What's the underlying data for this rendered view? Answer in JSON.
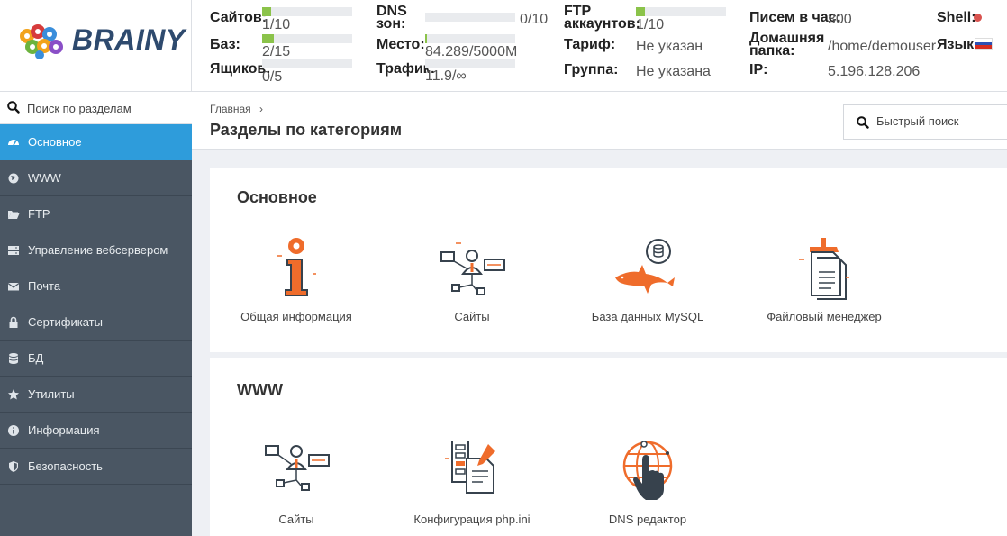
{
  "brand": {
    "name": "BRAINY"
  },
  "stats": {
    "sites": {
      "label": "Сайтов:",
      "value": "1/10",
      "fill": 0.1
    },
    "dbs": {
      "label": "Баз:",
      "value": "2/15",
      "fill": 0.13
    },
    "boxes": {
      "label": "Ящиков:",
      "value": "0/5",
      "fill": 0
    },
    "dns": {
      "label": "DNS зон:",
      "value": "0/10",
      "fill": 0
    },
    "space": {
      "label": "Место:",
      "value": "84.289/5000M",
      "fill": 0.017
    },
    "traffic": {
      "label": "Трафик:",
      "value": "11.9/∞",
      "fill": 0
    },
    "ftp": {
      "label": "FTP аккаунтов:",
      "value": "1/10",
      "fill": 0.1
    },
    "tariff": {
      "label": "Тариф:",
      "value": "Не указан"
    },
    "group": {
      "label": "Группа:",
      "value": "Не указана"
    },
    "mails": {
      "label": "Писем в час:",
      "value": "300"
    },
    "home": {
      "label": "Домашняя папка:",
      "value": "/home/demouser"
    },
    "ip": {
      "label": "IP:",
      "value": "5.196.128.206"
    },
    "shell": {
      "label": "Shell:",
      "status_color": "#d9534f"
    },
    "lang": {
      "label": "Язык:",
      "flag": "russia-flag"
    }
  },
  "sidebar": {
    "search_placeholder": "Поиск по разделам",
    "items": [
      {
        "label": "Основное",
        "icon": "dashboard-icon",
        "active": true
      },
      {
        "label": "WWW",
        "icon": "globe-icon"
      },
      {
        "label": "FTP",
        "icon": "folder-open-icon"
      },
      {
        "label": "Управление вебсервером",
        "icon": "server-icon"
      },
      {
        "label": "Почта",
        "icon": "envelope-icon"
      },
      {
        "label": "Сертификаты",
        "icon": "lock-icon"
      },
      {
        "label": "БД",
        "icon": "database-icon"
      },
      {
        "label": "Утилиты",
        "icon": "star-icon"
      },
      {
        "label": "Информация",
        "icon": "info-icon"
      },
      {
        "label": "Безопасность",
        "icon": "shield-icon"
      }
    ]
  },
  "main": {
    "breadcrumb": "Главная",
    "title": "Разделы по категориям",
    "quick_search_placeholder": "Быстрый поиск",
    "sections": [
      {
        "title": "Основное",
        "tiles": [
          {
            "label": "Общая информация",
            "icon": "info-icon"
          },
          {
            "label": "Сайты",
            "icon": "sites-icon"
          },
          {
            "label": "База данных MySQL",
            "icon": "mysql-dolphin-icon"
          },
          {
            "label": "Файловый менеджер",
            "icon": "file-manager-icon"
          }
        ]
      },
      {
        "title": "WWW",
        "tiles": [
          {
            "label": "Сайты",
            "icon": "sites-icon"
          },
          {
            "label": "Конфигурация php.ini",
            "icon": "php-config-icon"
          },
          {
            "label": "DNS редактор",
            "icon": "dns-globe-hand-icon"
          }
        ]
      }
    ]
  },
  "colors": {
    "accent": "#2e9cdb",
    "sidebar": "#4a5663",
    "orange": "#ef6c2b",
    "progress": "#8bc34a"
  }
}
